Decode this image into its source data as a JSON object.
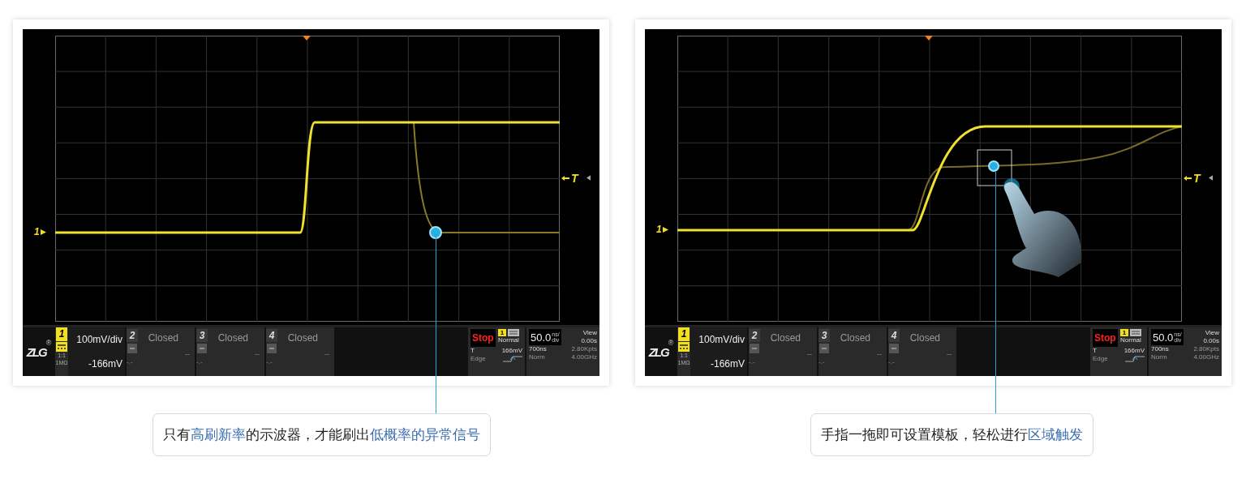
{
  "panels": [
    {
      "kind": "glitch",
      "channel_marker": "1",
      "trigger_marker": "T",
      "logo": "ZLG",
      "logo_mark": "®",
      "channel": {
        "number": "1",
        "scale": "100mV/div",
        "offset": "-166mV",
        "probe": "1:1",
        "impedance": "1MΩ"
      },
      "closed_channels": [
        {
          "number": "2",
          "label": "Closed",
          "value": "--",
          "sub": "-.-"
        },
        {
          "number": "3",
          "label": "Closed",
          "value": "--",
          "sub": "-.-"
        },
        {
          "number": "4",
          "label": "Closed",
          "value": "--",
          "sub": "-.-"
        }
      ],
      "trigger": {
        "state": "Stop",
        "source": "1",
        "mode": "Normal",
        "label": "T",
        "level": "166mV",
        "type": "Edge"
      },
      "timebase": {
        "value": "50.0",
        "unit_top": "ns/",
        "unit_bottom": "div",
        "view_label": "View",
        "view_value": "0.00s",
        "delay": "700ns",
        "points": "2.80Kpts",
        "acq": "Norm",
        "rate": "4.00GHz"
      },
      "caption": [
        {
          "text": "只有",
          "highlight": false
        },
        {
          "text": "高刷新率",
          "highlight": true
        },
        {
          "text": "的示波器，才能刷出",
          "highlight": false
        },
        {
          "text": "低概率的异常信号",
          "highlight": true
        }
      ]
    },
    {
      "kind": "zone",
      "channel_marker": "1",
      "trigger_marker": "T",
      "logo": "ZLG",
      "logo_mark": "®",
      "channel": {
        "number": "1",
        "scale": "100mV/div",
        "offset": "-166mV",
        "probe": "1:1",
        "impedance": "1MΩ"
      },
      "closed_channels": [
        {
          "number": "2",
          "label": "Closed",
          "value": "--",
          "sub": "-.-"
        },
        {
          "number": "3",
          "label": "Closed",
          "value": "--",
          "sub": "-.-"
        },
        {
          "number": "4",
          "label": "Closed",
          "value": "--",
          "sub": "-.-"
        }
      ],
      "trigger": {
        "state": "Stop",
        "source": "1",
        "mode": "Normal",
        "label": "T",
        "level": "166mV",
        "type": "Edge"
      },
      "timebase": {
        "value": "50.0",
        "unit_top": "ns/",
        "unit_bottom": "div",
        "view_label": "View",
        "view_value": "0.00s",
        "delay": "700ns",
        "points": "2.80Kpts",
        "acq": "Norm",
        "rate": "4.00GHz"
      },
      "caption": [
        {
          "text": "手指一拖即可设置模板，轻松进行",
          "highlight": false
        },
        {
          "text": "区域触发",
          "highlight": true
        }
      ]
    }
  ]
}
